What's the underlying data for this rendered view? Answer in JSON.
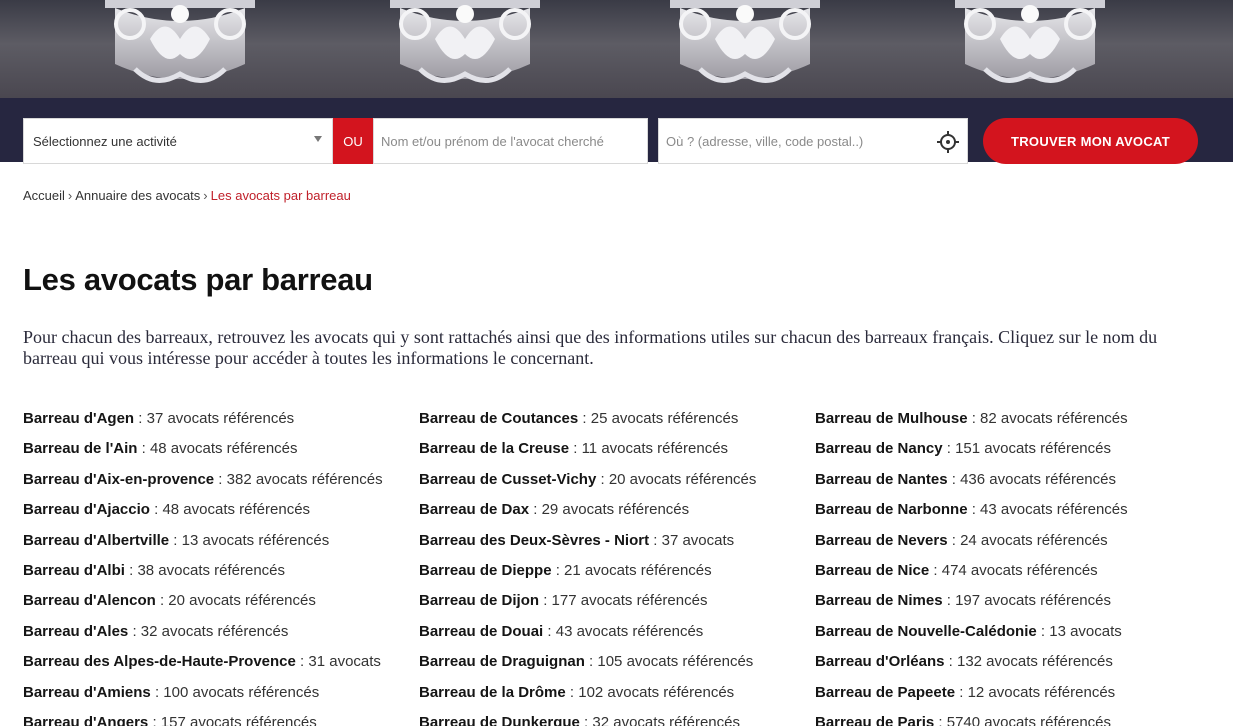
{
  "search": {
    "activity_placeholder": "Sélectionnez une activité",
    "or_label": "OU",
    "name_placeholder": "Nom et/ou prénom de l'avocat cherché",
    "where_placeholder": "Où ? (adresse, ville, code postal..)",
    "find_button": "TROUVER MON AVOCAT"
  },
  "breadcrumb": {
    "home": "Accueil",
    "directory": "Annuaire des avocats",
    "current": "Les avocats par barreau",
    "separator": "›"
  },
  "page": {
    "title": "Les avocats par barreau",
    "intro": "Pour chacun des barreaux, retrouvez les avocats qui y sont rattachés ainsi que des informations utiles sur chacun des barreaux français. Cliquez sur le nom du barreau qui vous intéresse pour accéder à toutes les informations le concernant."
  },
  "columns": [
    [
      {
        "name": "Barreau d'Agen",
        "count": " : 37 avocats référencés"
      },
      {
        "name": "Barreau de l'Ain",
        "count": " : 48 avocats référencés"
      },
      {
        "name": "Barreau d'Aix-en-provence",
        "count": " : 382 avocats référencés"
      },
      {
        "name": "Barreau d'Ajaccio",
        "count": " : 48 avocats référencés"
      },
      {
        "name": "Barreau d'Albertville",
        "count": " : 13 avocats référencés"
      },
      {
        "name": "Barreau d'Albi",
        "count": " : 38 avocats référencés"
      },
      {
        "name": "Barreau d'Alencon",
        "count": " : 20 avocats référencés"
      },
      {
        "name": "Barreau d'Ales",
        "count": " : 32 avocats référencés"
      },
      {
        "name": "Barreau des Alpes-de-Haute-Provence",
        "count": " : 31 avocats"
      },
      {
        "name": "Barreau d'Amiens",
        "count": " : 100 avocats référencés"
      },
      {
        "name": "Barreau d'Angers",
        "count": " : 157 avocats référencés"
      }
    ],
    [
      {
        "name": "Barreau de Coutances",
        "count": " : 25 avocats référencés"
      },
      {
        "name": "Barreau de la Creuse",
        "count": " : 11 avocats référencés"
      },
      {
        "name": "Barreau de Cusset-Vichy",
        "count": " : 20 avocats référencés"
      },
      {
        "name": "Barreau de Dax",
        "count": " : 29 avocats référencés"
      },
      {
        "name": "Barreau des Deux-Sèvres - Niort",
        "count": " : 37 avocats"
      },
      {
        "name": "Barreau de Dieppe",
        "count": " : 21 avocats référencés"
      },
      {
        "name": "Barreau de Dijon",
        "count": " : 177 avocats référencés"
      },
      {
        "name": "Barreau de Douai",
        "count": " : 43 avocats référencés"
      },
      {
        "name": "Barreau de Draguignan",
        "count": " : 105 avocats référencés"
      },
      {
        "name": "Barreau de la Drôme",
        "count": " : 102 avocats référencés"
      },
      {
        "name": "Barreau de Dunkerque",
        "count": " : 32 avocats référencés"
      }
    ],
    [
      {
        "name": "Barreau de Mulhouse",
        "count": " : 82 avocats référencés"
      },
      {
        "name": "Barreau de Nancy",
        "count": " : 151 avocats référencés"
      },
      {
        "name": "Barreau de Nantes",
        "count": " : 436 avocats référencés"
      },
      {
        "name": "Barreau de Narbonne",
        "count": " : 43 avocats référencés"
      },
      {
        "name": "Barreau de Nevers",
        "count": " : 24 avocats référencés"
      },
      {
        "name": "Barreau de Nice",
        "count": " : 474 avocats référencés"
      },
      {
        "name": "Barreau de Nimes",
        "count": " : 197 avocats référencés"
      },
      {
        "name": "Barreau de Nouvelle-Calédonie",
        "count": " : 13 avocats"
      },
      {
        "name": "Barreau d'Orléans",
        "count": " : 132 avocats référencés"
      },
      {
        "name": "Barreau de Papeete",
        "count": " : 12 avocats référencés"
      },
      {
        "name": "Barreau de Paris",
        "count": " : 5740 avocats référencés"
      }
    ]
  ],
  "icons": {
    "locate": "crosshair-icon",
    "dropdown": "caret-down-icon"
  },
  "colors": {
    "accent": "#d3141e",
    "search_strip": "#262640",
    "breadcrumb_current": "#c0202a"
  }
}
